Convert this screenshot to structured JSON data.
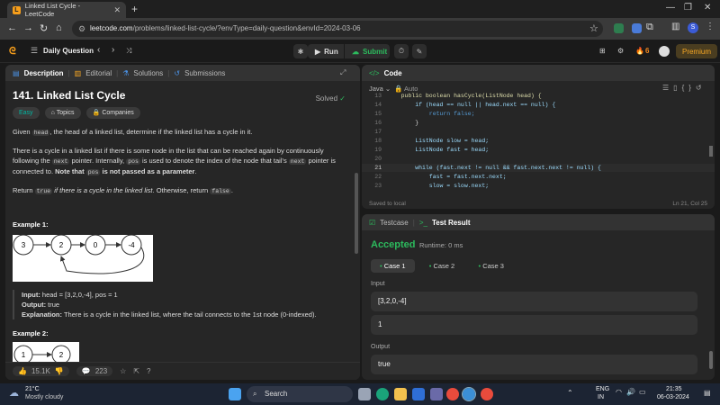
{
  "browser": {
    "tab_title": "Linked List Cycle - LeetCode",
    "url_domain": "leetcode.com",
    "url_path": "/problems/linked-list-cycle/?envType=daily-question&envId=2024-03-06"
  },
  "nav": {
    "daily": "Daily Question",
    "run": "Run",
    "submit": "Submit",
    "streak": "6",
    "premium": "Premium"
  },
  "desc": {
    "tabs": [
      "Description",
      "Editorial",
      "Solutions",
      "Submissions"
    ],
    "title": "141. Linked List Cycle",
    "solved": "Solved",
    "difficulty": "Easy",
    "topics": "Topics",
    "companies": "Companies",
    "p1_a": "Given ",
    "head": "head",
    "p1_b": ", the head of a linked list, determine if the linked list has a cycle in it.",
    "p2_a": "There is a cycle in a linked list if there is some node in the list that can be reached again by continuously following the ",
    "next": "next",
    "p2_b": " pointer. Internally, ",
    "pos": "pos",
    "p2_c": " is used to denote the index of the node that tail's ",
    "p2_d": " pointer is connected to. ",
    "p2_note": "Note that ",
    "p2_note2": " is not passed as a parameter",
    "p3_a": "Return ",
    "true": "true",
    "p3_b": " if there is a cycle in the linked list",
    "p3_c": ". Otherwise, return ",
    "false": "false",
    "ex1_title": "Example 1:",
    "ex1_nodes": [
      "3",
      "2",
      "0",
      "-4"
    ],
    "input_label": "Input:",
    "ex1_input": " head = [3,2,0,-4], pos = 1",
    "output_label": "Output:",
    "ex1_output": " true",
    "expl_label": "Explanation:",
    "ex1_expl": " There is a cycle in the linked list, where the tail connects to the 1st node (0-indexed).",
    "ex2_title": "Example 2:",
    "ex2_nodes": [
      "1",
      "2"
    ],
    "likes": "15.1K",
    "comments": "223"
  },
  "code": {
    "header": "Code",
    "lang": "Java",
    "auto": "Auto",
    "saved": "Saved to local",
    "cursor": "Ln 21, Col 25",
    "lines": [
      {
        "n": "13",
        "t": "    public boolean hasCycle(ListNode head) {"
      },
      {
        "n": "14",
        "t": "        if (head == null || head.next == null) {"
      },
      {
        "n": "15",
        "t": "            return false;"
      },
      {
        "n": "16",
        "t": "        }"
      },
      {
        "n": "17",
        "t": ""
      },
      {
        "n": "18",
        "t": "        ListNode slow = head;"
      },
      {
        "n": "19",
        "t": "        ListNode fast = head;"
      },
      {
        "n": "20",
        "t": ""
      },
      {
        "n": "21",
        "t": "        while (fast.next != null && fast.next.next != null) {"
      },
      {
        "n": "22",
        "t": "            fast = fast.next.next;"
      },
      {
        "n": "23",
        "t": "            slow = slow.next;"
      }
    ]
  },
  "test": {
    "tab_testcase": "Testcase",
    "tab_result": "Test Result",
    "status": "Accepted",
    "runtime": "Runtime: 0 ms",
    "cases": [
      "Case 1",
      "Case 2",
      "Case 3"
    ],
    "input_label": "Input",
    "input_head": "[3,2,0,-4]",
    "input_pos": "1",
    "output_label": "Output",
    "output_val": "true"
  },
  "taskbar": {
    "temp": "21°C",
    "weather": "Mostly cloudy",
    "search": "Search",
    "lang1": "ENG",
    "lang2": "IN",
    "time": "21:35",
    "date": "06-03-2024"
  }
}
